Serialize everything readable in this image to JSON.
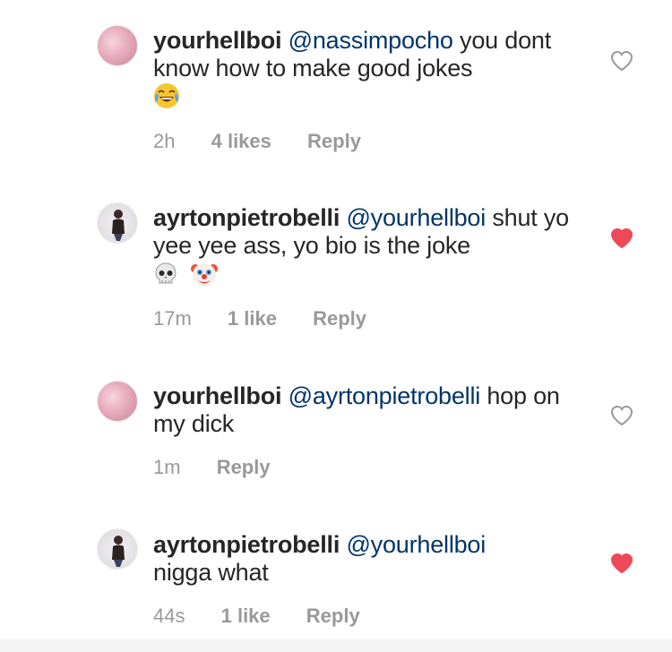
{
  "comments": [
    {
      "username": "yourhellboi",
      "mention": "@nassimpocho",
      "text": " you dont know how to make good jokes",
      "emoji": [
        "face-with-tears-of-joy-emoji"
      ],
      "time": "2h",
      "likes": "4 likes",
      "reply": "Reply",
      "liked": false,
      "avatar": "pink"
    },
    {
      "username": "ayrtonpietrobelli",
      "mention": "@yourhellboi",
      "text": " shut yo yee yee ass, yo bio is the joke",
      "emoji": [
        "skull-emoji",
        "clown-face-emoji"
      ],
      "time": "17m",
      "likes": "1 like",
      "reply": "Reply",
      "liked": true,
      "avatar": "dark"
    },
    {
      "username": "yourhellboi",
      "mention": "@ayrtonpietrobelli",
      "text": " hop on my dick",
      "emoji": [],
      "time": "1m",
      "likes": "",
      "reply": "Reply",
      "liked": false,
      "avatar": "pink"
    },
    {
      "username": "ayrtonpietrobelli",
      "mention": "@yourhellboi",
      "text": " nigga what",
      "emoji": [],
      "time": "44s",
      "likes": "1 like",
      "reply": "Reply",
      "liked": true,
      "avatar": "dark"
    }
  ],
  "colors": {
    "text": "#262626",
    "mention": "#003569",
    "meta": "#999999",
    "heart_liked": "#ed4956",
    "heart_outline": "#999999"
  }
}
